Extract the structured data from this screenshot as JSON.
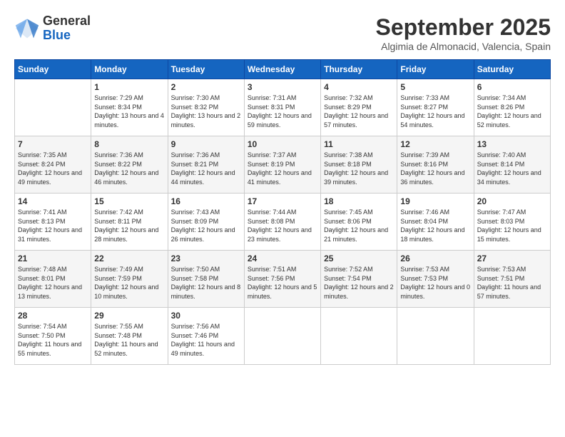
{
  "header": {
    "logo_general": "General",
    "logo_blue": "Blue",
    "month": "September 2025",
    "location": "Algimia de Almonacid, Valencia, Spain"
  },
  "days_of_week": [
    "Sunday",
    "Monday",
    "Tuesday",
    "Wednesday",
    "Thursday",
    "Friday",
    "Saturday"
  ],
  "weeks": [
    [
      {
        "day": "",
        "sunrise": "",
        "sunset": "",
        "daylight": ""
      },
      {
        "day": "1",
        "sunrise": "Sunrise: 7:29 AM",
        "sunset": "Sunset: 8:34 PM",
        "daylight": "Daylight: 13 hours and 4 minutes."
      },
      {
        "day": "2",
        "sunrise": "Sunrise: 7:30 AM",
        "sunset": "Sunset: 8:32 PM",
        "daylight": "Daylight: 13 hours and 2 minutes."
      },
      {
        "day": "3",
        "sunrise": "Sunrise: 7:31 AM",
        "sunset": "Sunset: 8:31 PM",
        "daylight": "Daylight: 12 hours and 59 minutes."
      },
      {
        "day": "4",
        "sunrise": "Sunrise: 7:32 AM",
        "sunset": "Sunset: 8:29 PM",
        "daylight": "Daylight: 12 hours and 57 minutes."
      },
      {
        "day": "5",
        "sunrise": "Sunrise: 7:33 AM",
        "sunset": "Sunset: 8:27 PM",
        "daylight": "Daylight: 12 hours and 54 minutes."
      },
      {
        "day": "6",
        "sunrise": "Sunrise: 7:34 AM",
        "sunset": "Sunset: 8:26 PM",
        "daylight": "Daylight: 12 hours and 52 minutes."
      }
    ],
    [
      {
        "day": "7",
        "sunrise": "Sunrise: 7:35 AM",
        "sunset": "Sunset: 8:24 PM",
        "daylight": "Daylight: 12 hours and 49 minutes."
      },
      {
        "day": "8",
        "sunrise": "Sunrise: 7:36 AM",
        "sunset": "Sunset: 8:22 PM",
        "daylight": "Daylight: 12 hours and 46 minutes."
      },
      {
        "day": "9",
        "sunrise": "Sunrise: 7:36 AM",
        "sunset": "Sunset: 8:21 PM",
        "daylight": "Daylight: 12 hours and 44 minutes."
      },
      {
        "day": "10",
        "sunrise": "Sunrise: 7:37 AM",
        "sunset": "Sunset: 8:19 PM",
        "daylight": "Daylight: 12 hours and 41 minutes."
      },
      {
        "day": "11",
        "sunrise": "Sunrise: 7:38 AM",
        "sunset": "Sunset: 8:18 PM",
        "daylight": "Daylight: 12 hours and 39 minutes."
      },
      {
        "day": "12",
        "sunrise": "Sunrise: 7:39 AM",
        "sunset": "Sunset: 8:16 PM",
        "daylight": "Daylight: 12 hours and 36 minutes."
      },
      {
        "day": "13",
        "sunrise": "Sunrise: 7:40 AM",
        "sunset": "Sunset: 8:14 PM",
        "daylight": "Daylight: 12 hours and 34 minutes."
      }
    ],
    [
      {
        "day": "14",
        "sunrise": "Sunrise: 7:41 AM",
        "sunset": "Sunset: 8:13 PM",
        "daylight": "Daylight: 12 hours and 31 minutes."
      },
      {
        "day": "15",
        "sunrise": "Sunrise: 7:42 AM",
        "sunset": "Sunset: 8:11 PM",
        "daylight": "Daylight: 12 hours and 28 minutes."
      },
      {
        "day": "16",
        "sunrise": "Sunrise: 7:43 AM",
        "sunset": "Sunset: 8:09 PM",
        "daylight": "Daylight: 12 hours and 26 minutes."
      },
      {
        "day": "17",
        "sunrise": "Sunrise: 7:44 AM",
        "sunset": "Sunset: 8:08 PM",
        "daylight": "Daylight: 12 hours and 23 minutes."
      },
      {
        "day": "18",
        "sunrise": "Sunrise: 7:45 AM",
        "sunset": "Sunset: 8:06 PM",
        "daylight": "Daylight: 12 hours and 21 minutes."
      },
      {
        "day": "19",
        "sunrise": "Sunrise: 7:46 AM",
        "sunset": "Sunset: 8:04 PM",
        "daylight": "Daylight: 12 hours and 18 minutes."
      },
      {
        "day": "20",
        "sunrise": "Sunrise: 7:47 AM",
        "sunset": "Sunset: 8:03 PM",
        "daylight": "Daylight: 12 hours and 15 minutes."
      }
    ],
    [
      {
        "day": "21",
        "sunrise": "Sunrise: 7:48 AM",
        "sunset": "Sunset: 8:01 PM",
        "daylight": "Daylight: 12 hours and 13 minutes."
      },
      {
        "day": "22",
        "sunrise": "Sunrise: 7:49 AM",
        "sunset": "Sunset: 7:59 PM",
        "daylight": "Daylight: 12 hours and 10 minutes."
      },
      {
        "day": "23",
        "sunrise": "Sunrise: 7:50 AM",
        "sunset": "Sunset: 7:58 PM",
        "daylight": "Daylight: 12 hours and 8 minutes."
      },
      {
        "day": "24",
        "sunrise": "Sunrise: 7:51 AM",
        "sunset": "Sunset: 7:56 PM",
        "daylight": "Daylight: 12 hours and 5 minutes."
      },
      {
        "day": "25",
        "sunrise": "Sunrise: 7:52 AM",
        "sunset": "Sunset: 7:54 PM",
        "daylight": "Daylight: 12 hours and 2 minutes."
      },
      {
        "day": "26",
        "sunrise": "Sunrise: 7:53 AM",
        "sunset": "Sunset: 7:53 PM",
        "daylight": "Daylight: 12 hours and 0 minutes."
      },
      {
        "day": "27",
        "sunrise": "Sunrise: 7:53 AM",
        "sunset": "Sunset: 7:51 PM",
        "daylight": "Daylight: 11 hours and 57 minutes."
      }
    ],
    [
      {
        "day": "28",
        "sunrise": "Sunrise: 7:54 AM",
        "sunset": "Sunset: 7:50 PM",
        "daylight": "Daylight: 11 hours and 55 minutes."
      },
      {
        "day": "29",
        "sunrise": "Sunrise: 7:55 AM",
        "sunset": "Sunset: 7:48 PM",
        "daylight": "Daylight: 11 hours and 52 minutes."
      },
      {
        "day": "30",
        "sunrise": "Sunrise: 7:56 AM",
        "sunset": "Sunset: 7:46 PM",
        "daylight": "Daylight: 11 hours and 49 minutes."
      },
      {
        "day": "",
        "sunrise": "",
        "sunset": "",
        "daylight": ""
      },
      {
        "day": "",
        "sunrise": "",
        "sunset": "",
        "daylight": ""
      },
      {
        "day": "",
        "sunrise": "",
        "sunset": "",
        "daylight": ""
      },
      {
        "day": "",
        "sunrise": "",
        "sunset": "",
        "daylight": ""
      }
    ]
  ]
}
